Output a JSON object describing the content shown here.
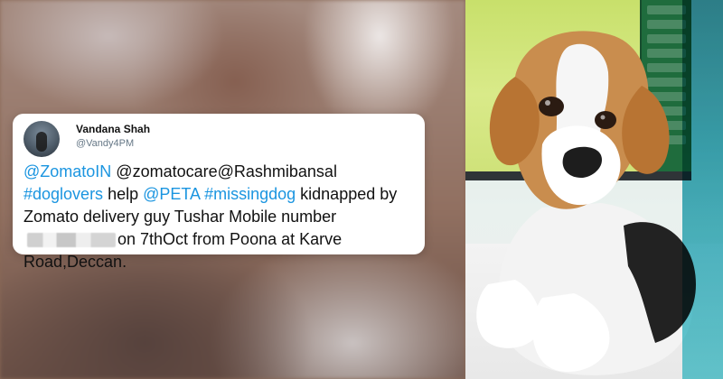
{
  "tweet": {
    "display_name": "Vandana Shah",
    "handle": "@Vandy4PM",
    "segments": [
      {
        "type": "link",
        "text": "@ZomatoIN"
      },
      {
        "type": "text",
        "text": " @zomatocare@Rashmibansal "
      },
      {
        "type": "link",
        "text": "#doglovers"
      },
      {
        "type": "text",
        "text": " help "
      },
      {
        "type": "link",
        "text": "@PETA"
      },
      {
        "type": "text",
        "text": " "
      },
      {
        "type": "link",
        "text": "#missingdog"
      },
      {
        "type": "text",
        "text": " kidnapped by Zomato delivery guy Tushar Mobile number "
      },
      {
        "type": "redacted",
        "text": ""
      },
      {
        "type": "text",
        "text": "on 7thOct from Poona at Karve Road,Deccan."
      }
    ]
  },
  "photo": {
    "subject": "beagle puppy",
    "screen_text_visible": false
  },
  "colors": {
    "link": "#1b95e0",
    "text": "#111111",
    "handle": "#657786",
    "card_bg": "#ffffff"
  },
  "icons": {
    "avatar": "user-avatar"
  }
}
